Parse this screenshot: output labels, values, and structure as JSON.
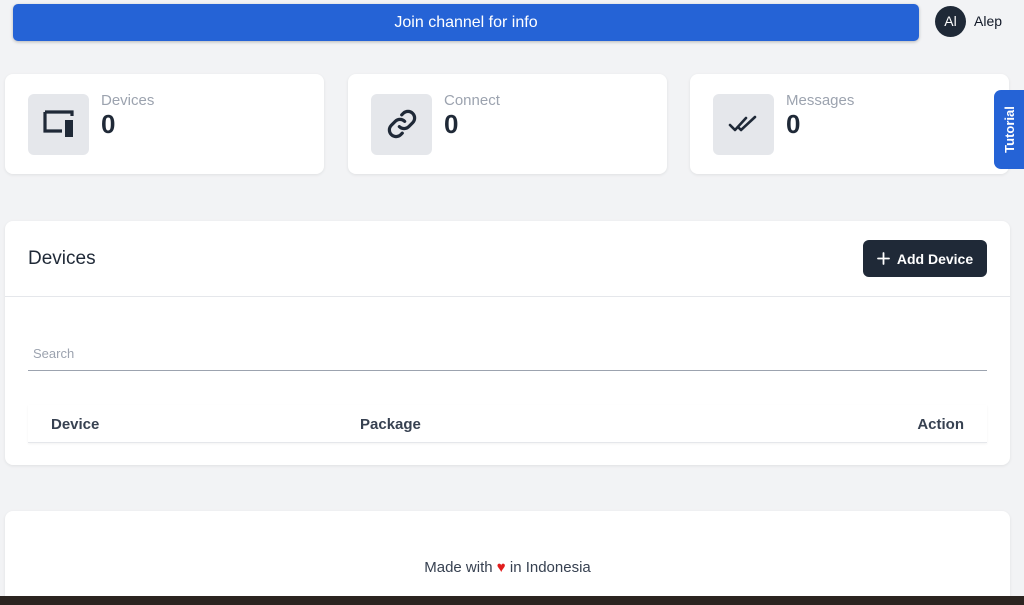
{
  "header": {
    "join_label": "Join channel for info",
    "user_initials": "Al",
    "user_name": "Alep"
  },
  "stats": [
    {
      "label": "Devices",
      "value": "0",
      "icon": "device-icon"
    },
    {
      "label": "Connect",
      "value": "0",
      "icon": "link-icon"
    },
    {
      "label": "Messages",
      "value": "0",
      "icon": "double-check-icon"
    }
  ],
  "tutorial_label": "Tutorial",
  "devices_panel": {
    "title": "Devices",
    "add_button": "Add Device",
    "search_placeholder": "Search",
    "columns": [
      "Device",
      "Package",
      "Action"
    ]
  },
  "footer": {
    "before": "Made with",
    "heart": "♥",
    "after": "in Indonesia"
  },
  "colors": {
    "primary": "#2563d6",
    "dark": "#1f2937",
    "background": "#f2f3f5",
    "heart": "#e11d1d"
  }
}
